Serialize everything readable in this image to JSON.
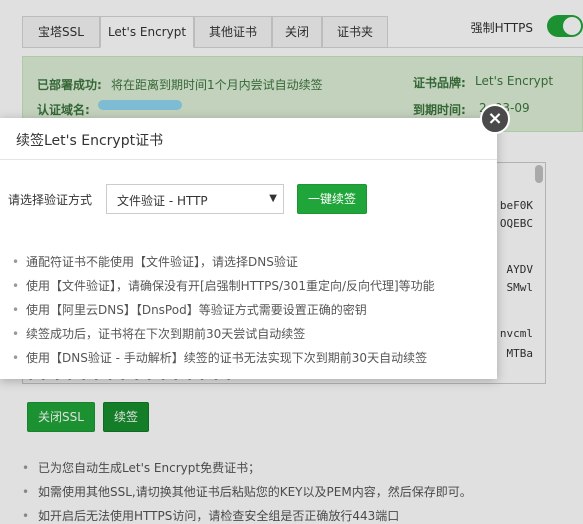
{
  "tabs": [
    "宝塔SSL",
    "Let's Encrypt",
    "其他证书",
    "关闭",
    "证书夹"
  ],
  "active_tab": "Let's Encrypt",
  "force_https": {
    "label": "强制HTTPS",
    "enabled": true
  },
  "status": {
    "deployed_label": "已部署成功:",
    "deployed_text": "将在距离到期时间1个月内尝试自动续签",
    "domain_label": "认证域名:",
    "brand_label": "证书品牌:",
    "brand_value": "Let's Encrypt",
    "expiry_label": "到期时间:",
    "expiry_value_partial": "2 -03-09"
  },
  "editor_fragments": [
    "beF0K",
    "OQEBC",
    "AYDV",
    "SMwl",
    "nvcml",
    "MTBa"
  ],
  "editor_bottom_line": "[ ] [ ] [ ] [ ] [ ] [ ] [ ] [ ]",
  "buttons": {
    "close_ssl": "关闭SSL",
    "renew": "续签"
  },
  "notes": [
    "已为您自动生成Let's Encrypt免费证书；",
    "如需使用其他SSL,请切换其他证书后粘贴您的KEY以及PEM内容，然后保存即可。",
    "如开启后无法使用HTTPS访问，请检查安全组是否正确放行443端口"
  ],
  "modal": {
    "title": "续签Let's Encrypt证书",
    "verify_label": "请选择验证方式",
    "verify_value": "文件验证 - HTTP",
    "one_click_label": "一键续签",
    "tips": [
      "通配符证书不能使用【文件验证】，请选择DNS验证",
      "使用【文件验证】，请确保没有开[启强制HTTPS/301重定向/反向代理]等功能",
      "使用【阿里云DNS】【DnsPod】等验证方式需要设置正确的密钥",
      "续签成功后，证书将在下次到期前30天尝试自动续签",
      "使用【DNS验证 - 手动解析】续签的证书无法实现下次到期前30天自动续签"
    ]
  },
  "colors": {
    "accent": "#20a53a",
    "info_bg": "#dff0d8",
    "info_text": "#3c763d"
  }
}
